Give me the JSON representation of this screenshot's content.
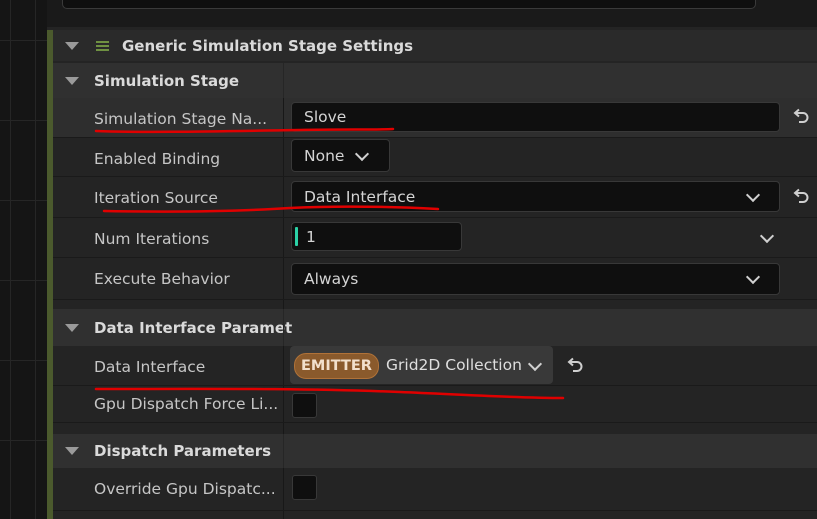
{
  "sections": {
    "generic": "Generic Simulation Stage Settings",
    "simulation_stage": "Simulation Stage",
    "data_interface_params": "Data Interface Paramet",
    "dispatch_params": "Dispatch Parameters"
  },
  "rows": {
    "stage_name": {
      "label": "Simulation Stage Na...",
      "value": "Slove"
    },
    "enabled_binding": {
      "label": "Enabled Binding",
      "value": "None"
    },
    "iteration_source": {
      "label": "Iteration Source",
      "value": "Data Interface"
    },
    "num_iterations": {
      "label": "Num Iterations",
      "value": "1"
    },
    "execute_behavior": {
      "label": "Execute Behavior",
      "value": "Always"
    },
    "data_interface": {
      "label": "Data Interface",
      "badge": "EMITTER",
      "value": "Grid2D Collection"
    },
    "gpu_dispatch_force": {
      "label": "Gpu Dispatch Force Li...",
      "checked": false
    },
    "override_gpu_dispatch": {
      "label": "Override Gpu Dispatc...",
      "checked": false
    }
  },
  "colors": {
    "panel_bg": "#242424",
    "section_bg": "#303030",
    "accent_bar": "#4b5a2d",
    "emitter_badge": "#8a5a2c",
    "annotation": "#e00000"
  },
  "icons": [
    "collapse-arrow-icon",
    "hamburger-icon",
    "chevron-down-icon",
    "reset-arrow-icon"
  ]
}
